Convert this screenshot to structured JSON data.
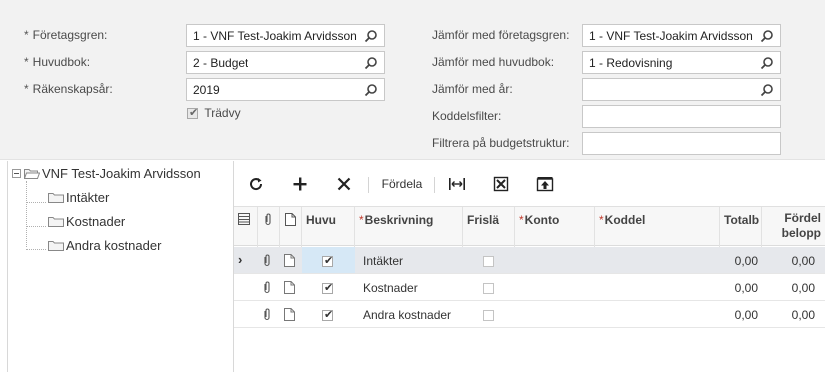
{
  "filters": {
    "company_label": "Företagsgren:",
    "company_value": "1 - VNF Test-Joakim Arvidsson",
    "ledger_label": "Huvudbok:",
    "ledger_value": "2 - Budget",
    "year_label": "Räkenskapsår:",
    "year_value": "2019",
    "treeview_label": "Trädvy",
    "compare_company_label": "Jämför med företagsgren:",
    "compare_company_value": "1 - VNF Test-Joakim Arvidsson",
    "compare_ledger_label": "Jämför med huvudbok:",
    "compare_ledger_value": "1 - Redovisning",
    "compare_year_label": "Jämför med år:",
    "compare_year_value": "",
    "subaccount_filter_label": "Koddelsfilter:",
    "subaccount_filter_value": "",
    "budget_structure_filter_label": "Filtrera på budgetstruktur:",
    "budget_structure_filter_value": "",
    "required_mark": "*"
  },
  "tree": {
    "root": "VNF Test-Joakim Arvidsson",
    "children": [
      "Intäkter",
      "Kostnader",
      "Andra kostnader"
    ]
  },
  "toolbar": {
    "distribute_label": "Fördela"
  },
  "grid": {
    "headers": {
      "node": "Huvu",
      "description": "Beskrivning",
      "free": "Frislä",
      "account": "Konto",
      "subaccount": "Koddel",
      "total": "Totalb",
      "distributed_line1": "Fördel",
      "distributed_line2": "belopp"
    },
    "rows": [
      {
        "indicator": "›",
        "node": true,
        "description": "Intäkter",
        "free": false,
        "account": "",
        "subaccount": "",
        "total": "0,00",
        "distributed": "0,00"
      },
      {
        "indicator": "",
        "node": true,
        "description": "Kostnader",
        "free": false,
        "account": "",
        "subaccount": "",
        "total": "0,00",
        "distributed": "0,00"
      },
      {
        "indicator": "",
        "node": true,
        "description": "Andra kostnader",
        "free": false,
        "account": "",
        "subaccount": "",
        "total": "0,00",
        "distributed": "0,00"
      }
    ]
  },
  "colors": {
    "panel_bg": "#f2f2f2",
    "selected_row": "#e6e8ec",
    "editing_cell": "#d6e8f6",
    "required": "#c0392b"
  }
}
